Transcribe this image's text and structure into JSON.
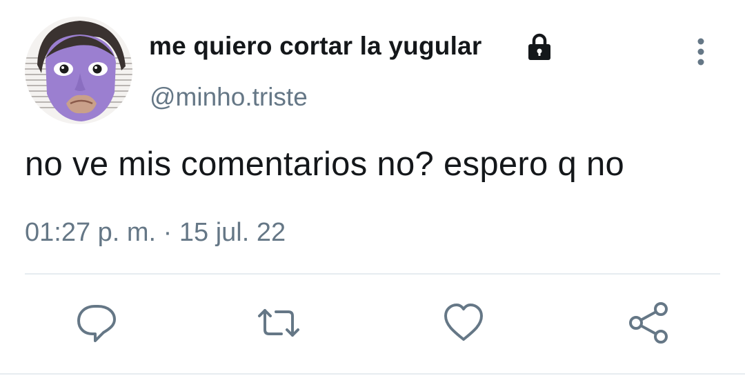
{
  "tweet": {
    "display_name": "me quiero cortar la yugular",
    "handle": "@minho.triste",
    "text": "no ve mis comentarios no? espero q no",
    "timestamp": "01:27 p. m. · 15 jul. 22"
  },
  "icons": {
    "lock": "lock-icon",
    "more": "more-vertical-icon",
    "reply": "reply-icon",
    "retweet": "retweet-icon",
    "like": "heart-icon",
    "share": "share-icon"
  },
  "colors": {
    "text": "#14171a",
    "secondary": "#657786",
    "divider": "#e6ecf0",
    "avatar_face": "#9b7fd0"
  }
}
